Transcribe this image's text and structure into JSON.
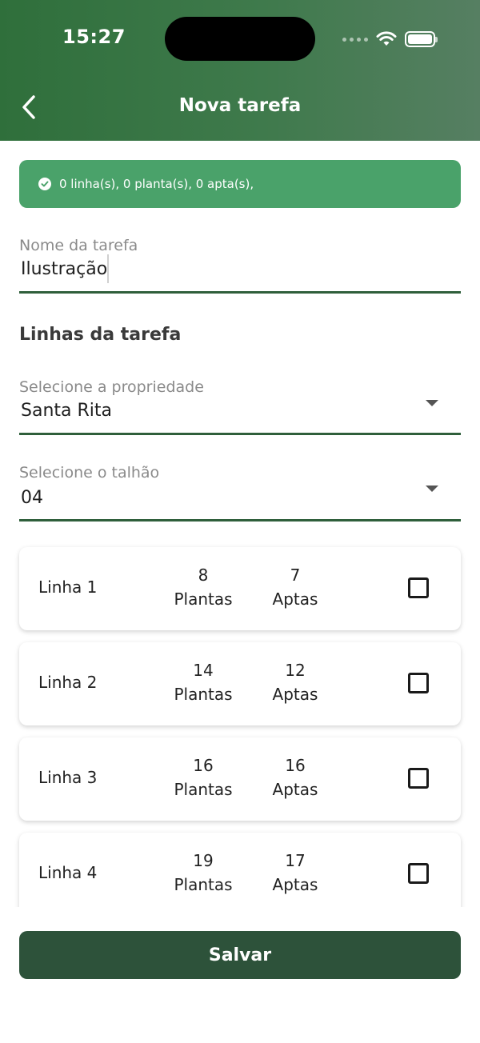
{
  "status_bar": {
    "time": "15:27"
  },
  "header": {
    "title": "Nova tarefa"
  },
  "banner": {
    "text": "0 linha(s), 0 planta(s), 0 apta(s),"
  },
  "form": {
    "task_name": {
      "label": "Nome da tarefa",
      "value": "Ilustração"
    },
    "section_title": "Linhas da tarefa",
    "property": {
      "label": "Selecione a propriedade",
      "value": "Santa Rita"
    },
    "plot": {
      "label": "Selecione o talhão",
      "value": "04"
    }
  },
  "rows": [
    {
      "name": "Linha 1",
      "plants": "8",
      "plants_label": "Plantas",
      "aptas": "7",
      "aptas_label": "Aptas",
      "checked": false
    },
    {
      "name": "Linha 2",
      "plants": "14",
      "plants_label": "Plantas",
      "aptas": "12",
      "aptas_label": "Aptas",
      "checked": false
    },
    {
      "name": "Linha 3",
      "plants": "16",
      "plants_label": "Plantas",
      "aptas": "16",
      "aptas_label": "Aptas",
      "checked": false
    },
    {
      "name": "Linha 4",
      "plants": "19",
      "plants_label": "Plantas",
      "aptas": "17",
      "aptas_label": "Aptas",
      "checked": false
    }
  ],
  "save_button": {
    "label": "Salvar"
  },
  "colors": {
    "header": "#3f7a4c",
    "banner": "#4aa26a",
    "save_button": "#2d523a",
    "field_underline": "#2f5f3b"
  },
  "icons": {
    "back": "chevron-left-icon",
    "banner": "check-circle-icon",
    "dropdown": "caret-down-icon",
    "wifi": "wifi-icon",
    "battery": "battery-icon"
  }
}
